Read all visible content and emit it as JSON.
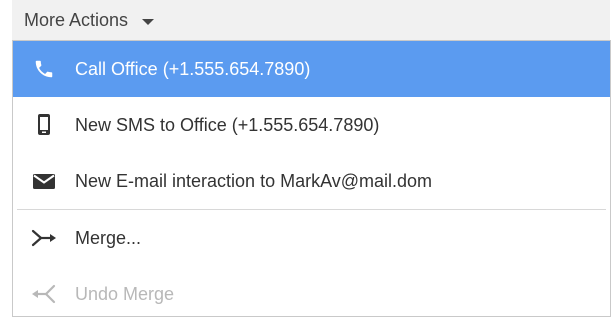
{
  "trigger": {
    "label": "More Actions",
    "icon": "caret-down-icon"
  },
  "menu": {
    "items": [
      {
        "label": "Call Office (+1.555.654.7890)",
        "icon": "phone-icon",
        "state": "highlighted"
      },
      {
        "label": "New SMS to Office (+1.555.654.7890)",
        "icon": "mobile-phone-icon",
        "state": "normal"
      },
      {
        "label": "New E-mail interaction to MarkAv@mail.dom",
        "icon": "envelope-icon",
        "state": "normal"
      },
      {
        "label": "Merge...",
        "icon": "merge-icon",
        "state": "normal"
      },
      {
        "label": "Undo Merge",
        "icon": "undo-merge-icon",
        "state": "disabled"
      }
    ]
  },
  "colors": {
    "highlight": "#5b9bf0",
    "text": "#333333",
    "disabled_text": "#b8b8b8",
    "trigger_bg": "#f1f1f1"
  }
}
